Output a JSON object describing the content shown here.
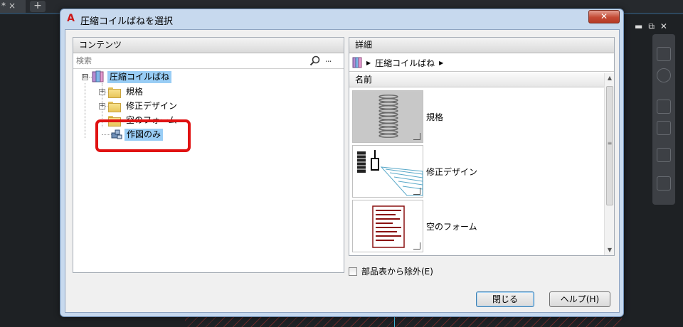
{
  "app": {
    "tab_label": "*",
    "tab_close": "×",
    "tab_add": "+",
    "canvas_controls": [
      "▬",
      "⧉",
      "✕"
    ]
  },
  "dialog": {
    "title": "圧縮コイルばねを選択",
    "app_icon": "A",
    "close_label": "✕"
  },
  "contents_panel": {
    "header": "コンテンツ",
    "search_placeholder": "検索",
    "more_label": "...",
    "tree": {
      "root": {
        "label": "圧縮コイルばね",
        "expander": "⊟"
      },
      "children": [
        {
          "label": "規格",
          "expander": "+"
        },
        {
          "label": "修正デザイン",
          "expander": "+"
        },
        {
          "label": "空のフォーム",
          "expander": ""
        },
        {
          "label": "作図のみ",
          "expander": ""
        }
      ]
    }
  },
  "details_panel": {
    "header": "詳細",
    "breadcrumb": "圧縮コイルばね",
    "column_header": "名前",
    "items": [
      {
        "label": "規格",
        "icon": "spring-icon"
      },
      {
        "label": "修正デザイン",
        "icon": "modified-design-icon"
      },
      {
        "label": "空のフォーム",
        "icon": "blank-form-icon"
      }
    ]
  },
  "options": {
    "exclude_from_bom_label": "部品表から除外(E)",
    "exclude_from_bom_checked": false
  },
  "buttons": {
    "close_label": "閉じる",
    "help_label": "ヘルプ(H)"
  },
  "colors": {
    "selection": "#99cdf5",
    "callout": "#e01212",
    "dialog_frame": "#c7d9ee"
  }
}
